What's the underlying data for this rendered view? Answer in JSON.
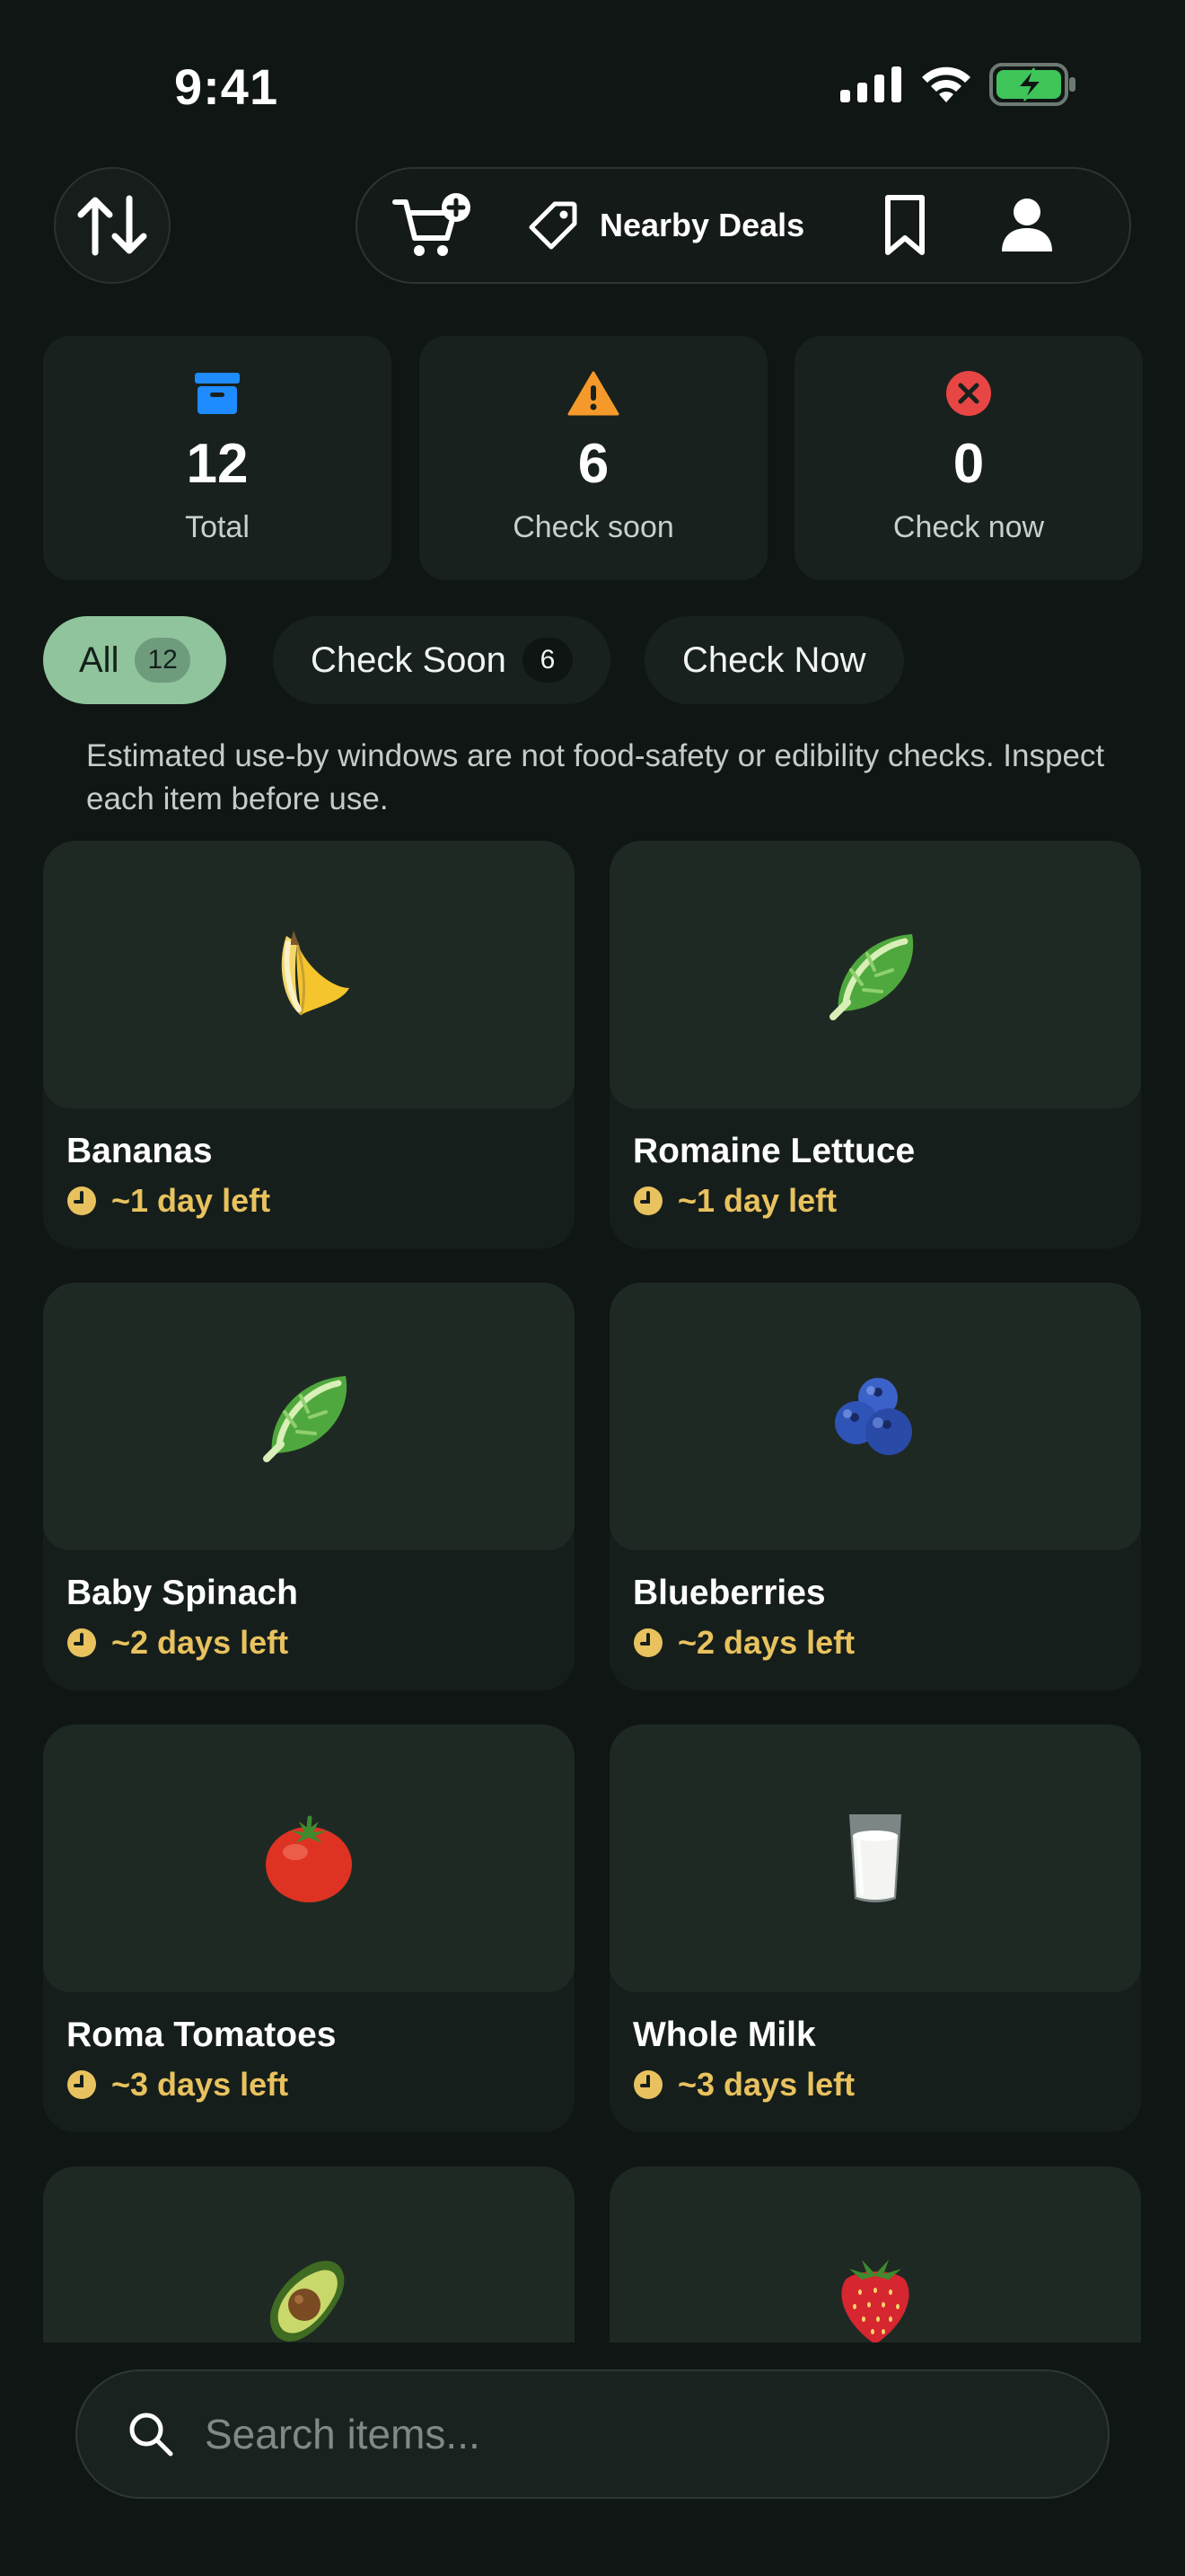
{
  "status_bar": {
    "time": "9:41"
  },
  "toolbar": {
    "deals_label": "Nearby Deals"
  },
  "stats": [
    {
      "value": "12",
      "label": "Total",
      "icon": "archive-icon",
      "color": "#1e8bff"
    },
    {
      "value": "6",
      "label": "Check soon",
      "icon": "warning-icon",
      "color": "#f59a2a"
    },
    {
      "value": "0",
      "label": "Check now",
      "icon": "error-icon",
      "color": "#e84545"
    }
  ],
  "filters": [
    {
      "label": "All",
      "count": "12",
      "active": true
    },
    {
      "label": "Check Soon",
      "count": "6",
      "active": false
    },
    {
      "label": "Check Now",
      "active": false
    }
  ],
  "disclaimer": "Estimated use-by windows are not food-safety or edibility checks. Inspect each item before use.",
  "items": [
    {
      "name": "Bananas",
      "time_left": "~1 day left",
      "icon": "banana-icon"
    },
    {
      "name": "Romaine Lettuce",
      "time_left": "~1 day left",
      "icon": "leafy-greens-icon"
    },
    {
      "name": "Baby Spinach",
      "time_left": "~2 days left",
      "icon": "leafy-greens-icon"
    },
    {
      "name": "Blueberries",
      "time_left": "~2 days left",
      "icon": "blueberries-icon"
    },
    {
      "name": "Roma Tomatoes",
      "time_left": "~3 days left",
      "icon": "tomato-icon"
    },
    {
      "name": "Whole Milk",
      "time_left": "~3 days left",
      "icon": "milk-glass-icon"
    },
    {
      "icon": "avocado-icon"
    },
    {
      "icon": "strawberry-icon"
    }
  ],
  "search": {
    "placeholder": "Search items..."
  },
  "colors": {
    "accent": "#8fc49d",
    "warning_text": "#e8c25e",
    "background": "#101614"
  }
}
